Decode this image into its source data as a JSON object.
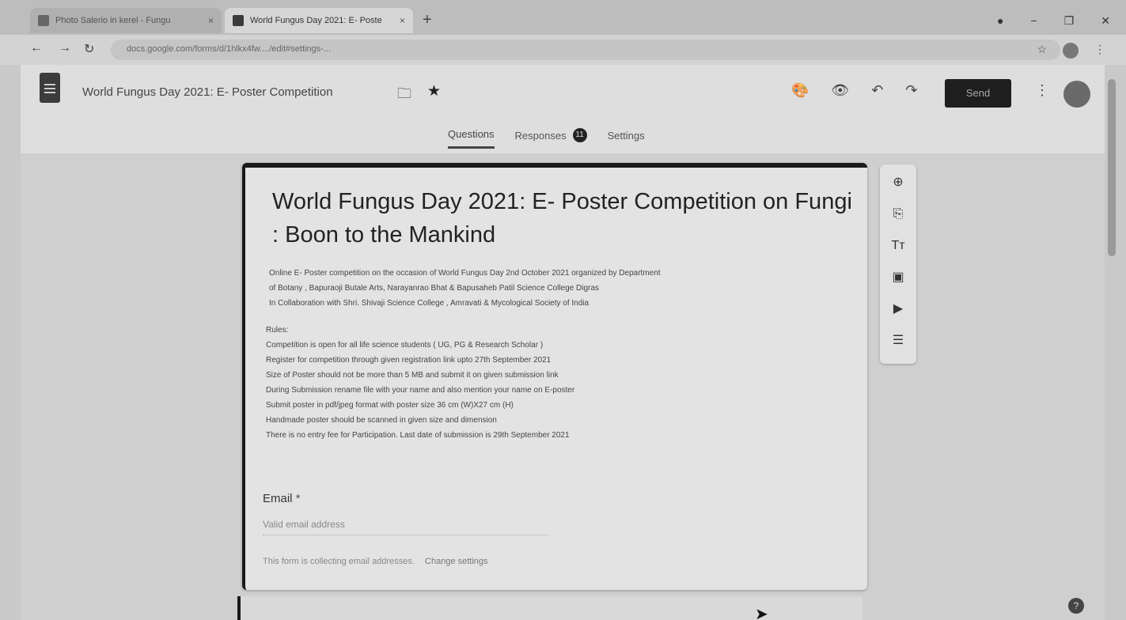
{
  "browser": {
    "tabs": [
      {
        "title": "Photo Salerio in kerel - Fungu",
        "close": "×"
      },
      {
        "title": "World Fungus Day 2021: E- Poste",
        "close": "×"
      }
    ],
    "new_tab": "+",
    "url": "docs.google.com/forms/d/1hlkx4fw..../edit#settings-...",
    "window_controls": {
      "minimize": "−",
      "restore": "❐",
      "close": "✕"
    }
  },
  "form_header": {
    "title": "World Fungus Day 2021: E- Poster Competition",
    "send_label": "Send",
    "tabs": [
      {
        "label": "Questions"
      },
      {
        "label": "Responses",
        "badge": "11"
      },
      {
        "label": "Settings"
      }
    ]
  },
  "form": {
    "title": "World Fungus Day 2021: E- Poster Competition on Fungi : Boon to the Mankind",
    "description": [
      "Online E- Poster competition on the occasion of World Fungus Day 2nd October 2021 organized by Department",
      "of Botany , Bapuraoji Butale Arts, Narayanrao Bhat & Bapusaheb Patil Science College Digras",
      "In Collaboration with Shri. Shivaji Science College , Amravati & Mycological Society of India"
    ],
    "rules_heading": "Rules:",
    "rules": [
      "Competition is open for all life science students ( UG, PG & Research Scholar )",
      "Register for competition through given registration link upto 27th September 2021",
      "Size of Poster should not be more than 5 MB and submit it on given submission link",
      "During Submission rename file with your name and also mention your name on E-poster",
      "Submit poster in pdf/jpeg format with poster size 36 cm (W)X27 cm (H)",
      "Handmade poster should be scanned in given size and dimension",
      "There is no entry fee for Participation. Last date of submission is 29th September 2021"
    ],
    "email": {
      "label": "Email",
      "required_mark": "*",
      "placeholder": "Valid email address",
      "note": "This form is collecting email addresses.",
      "change_link": "Change settings"
    }
  }
}
